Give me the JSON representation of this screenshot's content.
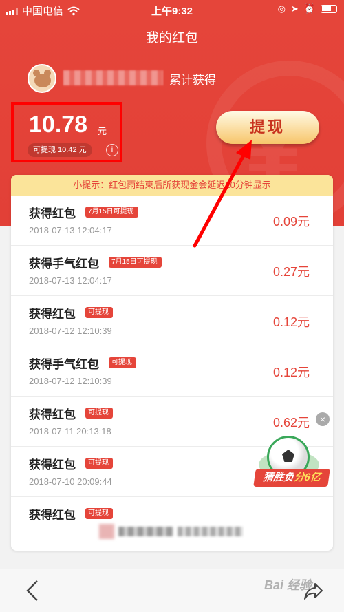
{
  "status_bar": {
    "carrier": "中国电信",
    "time": "上午9:32"
  },
  "page": {
    "title": "我的红包"
  },
  "summary": {
    "cumulative_label": "累计获得",
    "amount": "10.78",
    "unit": "元",
    "withdrawable_text": "可提现 10.42 元"
  },
  "withdraw_button": {
    "label": "提现"
  },
  "tip": {
    "text": "小提示：红包雨结束后所获现金会延迟20分钟显示"
  },
  "records": [
    {
      "title": "获得红包",
      "badge": "7月15日可提现",
      "date": "2018-07-13 12:04:17",
      "amount": "0.09元"
    },
    {
      "title": "获得手气红包",
      "badge": "7月15日可提现",
      "date": "2018-07-13 12:04:17",
      "amount": "0.27元"
    },
    {
      "title": "获得红包",
      "badge": "可提现",
      "date": "2018-07-12 12:10:39",
      "amount": "0.12元"
    },
    {
      "title": "获得手气红包",
      "badge": "可提现",
      "date": "2018-07-12 12:10:39",
      "amount": "0.12元"
    },
    {
      "title": "获得红包",
      "badge": "可提现",
      "date": "2018-07-11 20:13:18",
      "amount": "0.62元"
    },
    {
      "title": "获得红包",
      "badge": "可提现",
      "date": "2018-07-10 20:09:44",
      "amount": ""
    },
    {
      "title": "获得红包",
      "badge": "可提现",
      "date": "",
      "amount": ""
    }
  ],
  "promo": {
    "label_prefix": "猜胜负",
    "label_highlight": "分6亿"
  },
  "watermark": {
    "text": "Bai 经验"
  },
  "colors": {
    "brand_red": "#e5453a",
    "tip_bg": "#fbe49a",
    "button_gold": "#f7c56a",
    "annotation_red": "#ff0000"
  }
}
